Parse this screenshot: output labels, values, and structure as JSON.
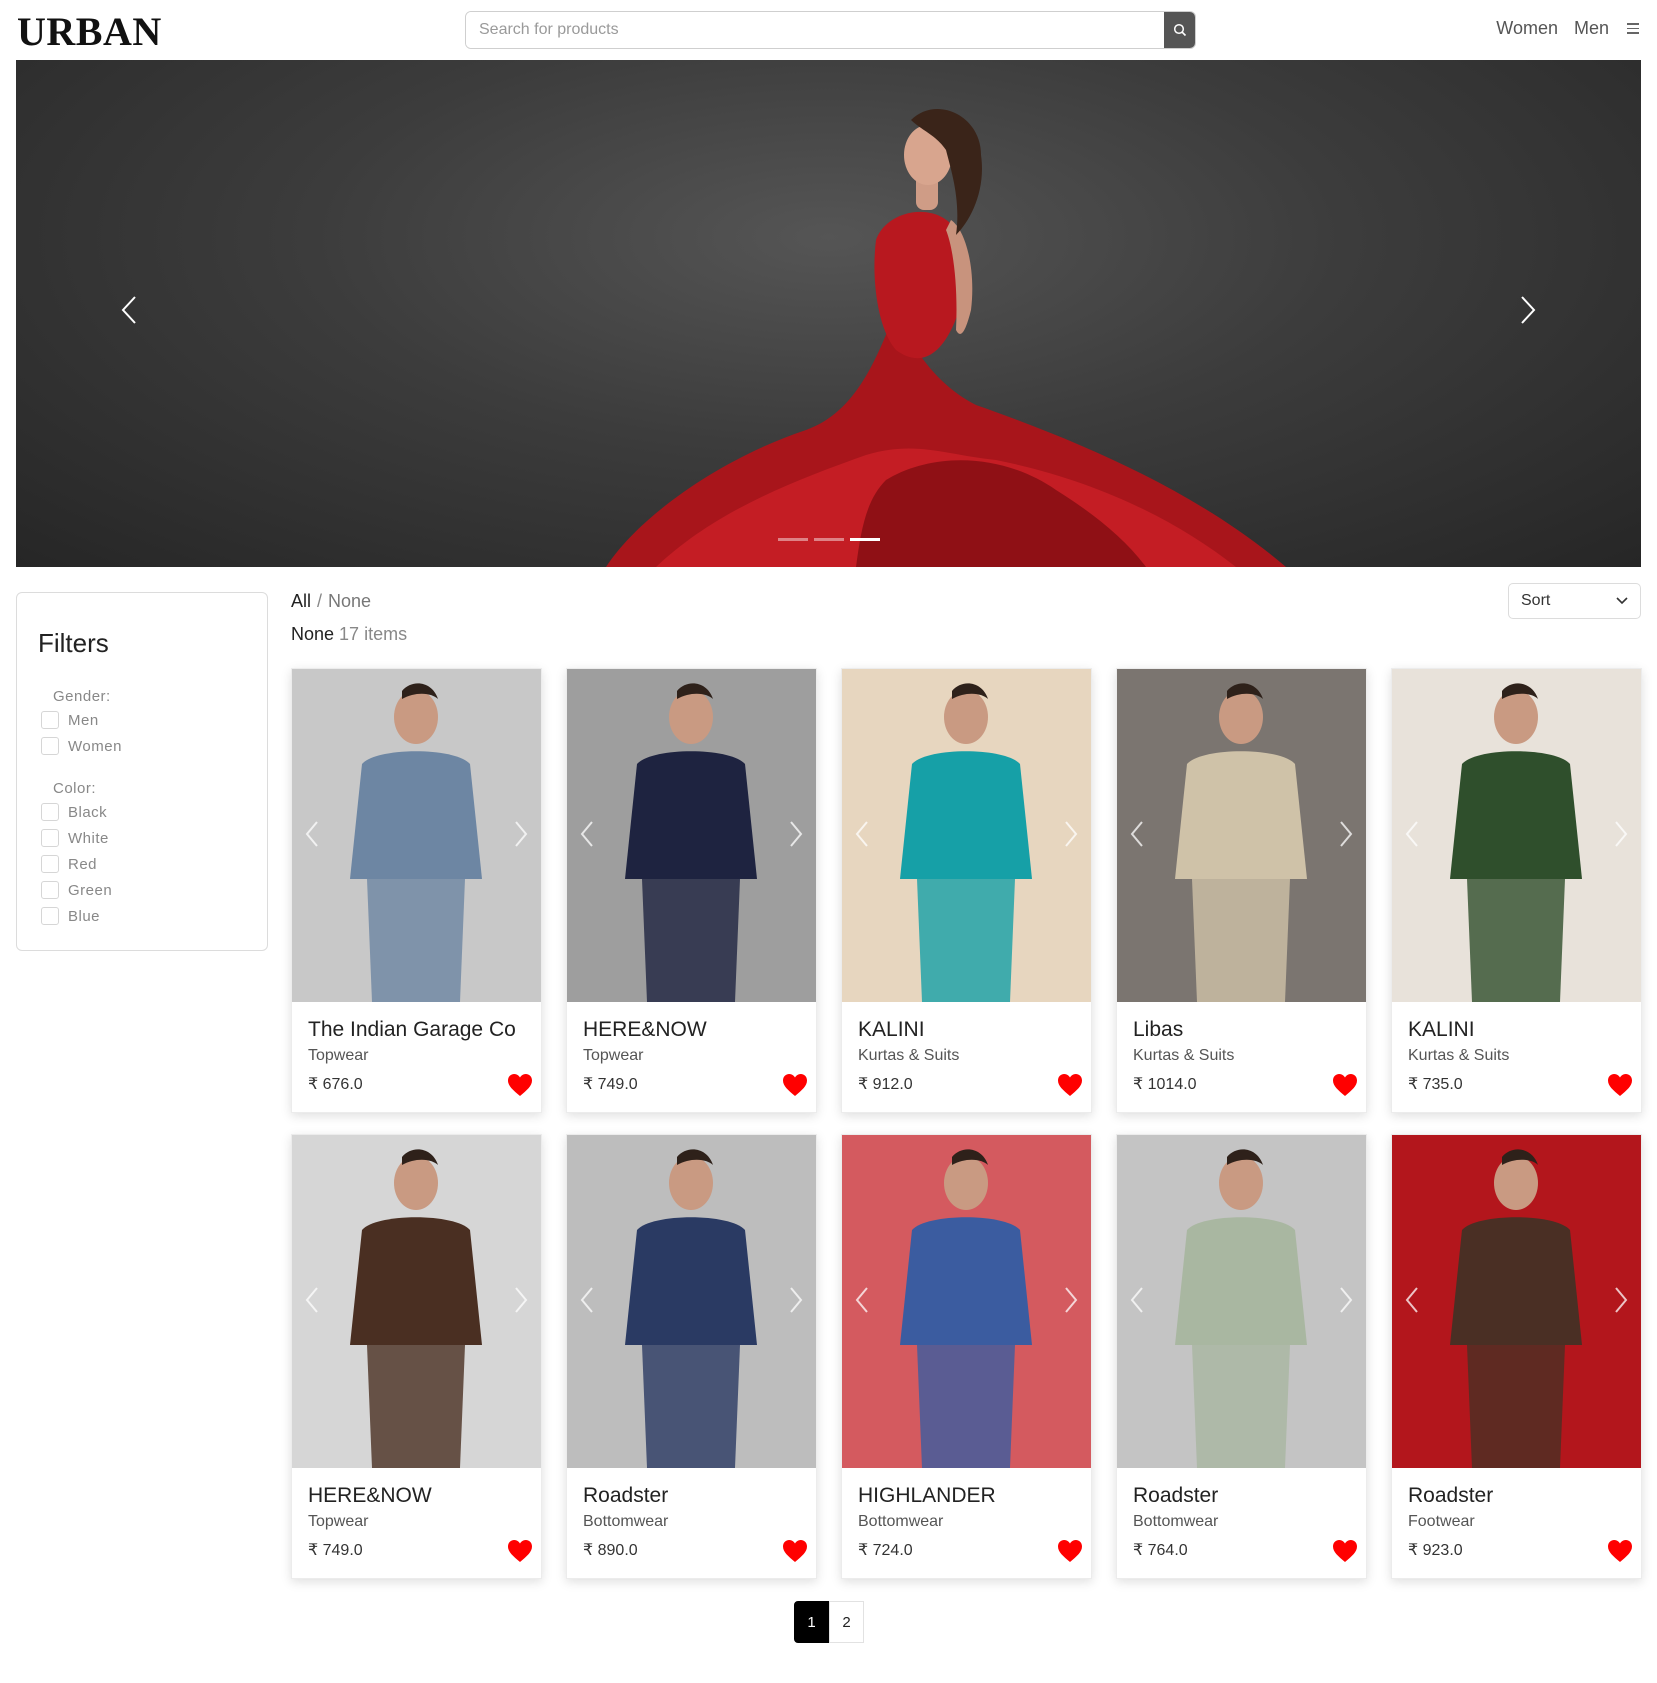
{
  "header": {
    "logo": "URBAN",
    "search_placeholder": "Search for products",
    "nav": [
      "Women",
      "Men"
    ]
  },
  "hero": {
    "dots": 3,
    "active_dot": 2,
    "colors": {
      "dress": "#c41d24",
      "backdrop": "#3c3c3c"
    }
  },
  "filters": {
    "title": "Filters",
    "gender_label": "Gender:",
    "gender_options": [
      "Men",
      "Women"
    ],
    "color_label": "Color:",
    "color_options": [
      "Black",
      "White",
      "Red",
      "Green",
      "Blue"
    ]
  },
  "breadcrumb": {
    "root": "All",
    "separator": "/",
    "current": "None"
  },
  "listing": {
    "category": "None",
    "count": "17 items"
  },
  "sort": {
    "label": "Sort"
  },
  "products": [
    {
      "brand": "The Indian Garage Co",
      "category": "Topwear",
      "price": "₹ 676.0",
      "bg": "#c8c8c8",
      "accent": "#6d86a3"
    },
    {
      "brand": "HERE&NOW",
      "category": "Topwear",
      "price": "₹ 749.0",
      "bg": "#9e9e9e",
      "accent": "#1e2340"
    },
    {
      "brand": "KALINI",
      "category": "Kurtas & Suits",
      "price": "₹ 912.0",
      "bg": "#e7d6bf",
      "accent": "#16a0a7"
    },
    {
      "brand": "Libas",
      "category": "Kurtas & Suits",
      "price": "₹ 1014.0",
      "bg": "#7b7570",
      "accent": "#cfc2a8"
    },
    {
      "brand": "KALINI",
      "category": "Kurtas & Suits",
      "price": "₹ 735.0",
      "bg": "#e8e2da",
      "accent": "#2f4f2c"
    },
    {
      "brand": "HERE&NOW",
      "category": "Topwear",
      "price": "₹ 749.0",
      "bg": "#d6d6d6",
      "accent": "#4a2f22"
    },
    {
      "brand": "Roadster",
      "category": "Bottomwear",
      "price": "₹ 890.0",
      "bg": "#bdbdbd",
      "accent": "#2a3a63"
    },
    {
      "brand": "HIGHLANDER",
      "category": "Bottomwear",
      "price": "₹ 724.0",
      "bg": "#d45a5f",
      "accent": "#3b5ca0"
    },
    {
      "brand": "Roadster",
      "category": "Bottomwear",
      "price": "₹ 764.0",
      "bg": "#c4c4c4",
      "accent": "#a9b7a1"
    },
    {
      "brand": "Roadster",
      "category": "Footwear",
      "price": "₹ 923.0",
      "bg": "#b3161c",
      "accent": "#4a2f24"
    }
  ],
  "pagination": {
    "pages": [
      "1",
      "2"
    ],
    "active": "1"
  },
  "colors": {
    "heart": "#ff0000",
    "search_button": "#555555",
    "active_page": "#000000"
  }
}
